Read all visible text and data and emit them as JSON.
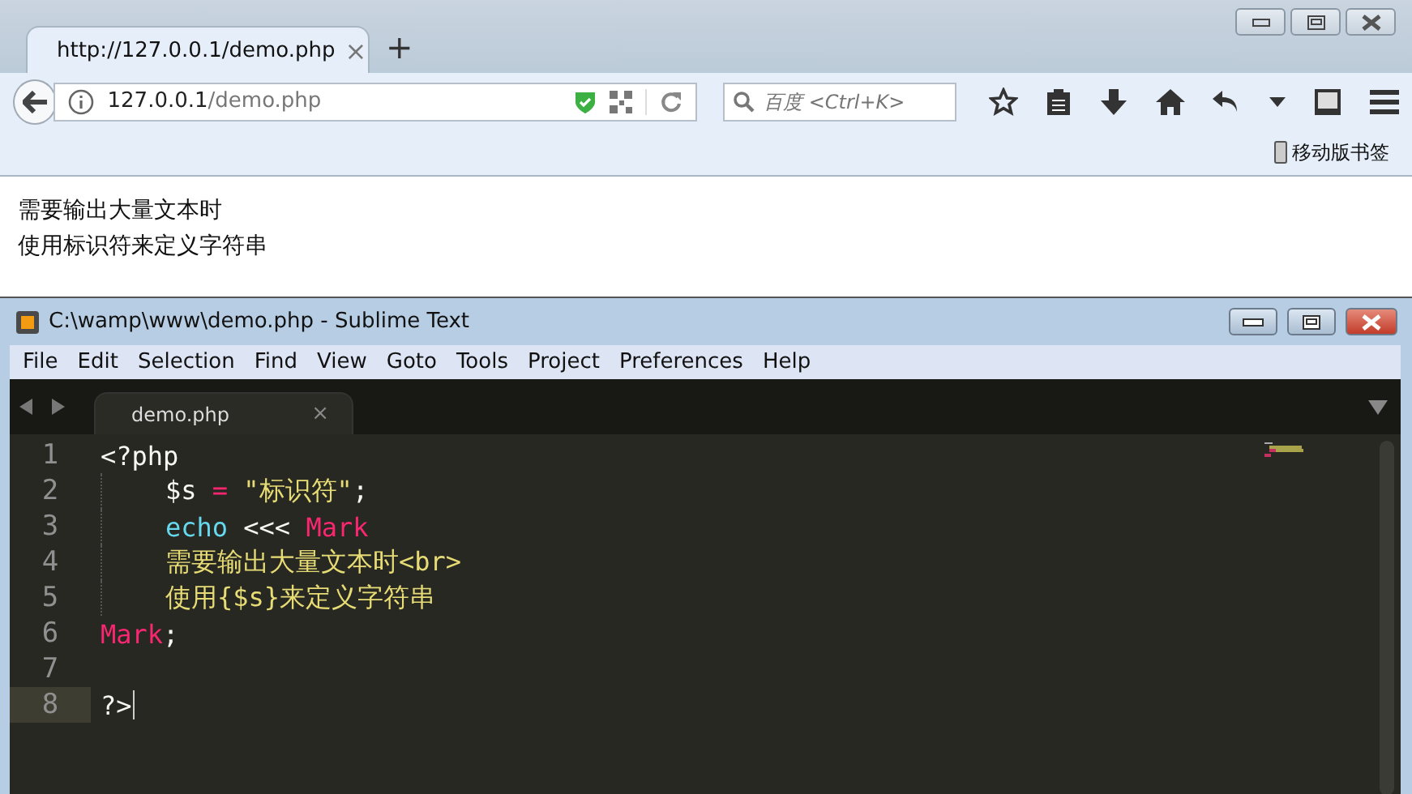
{
  "browser": {
    "tab": {
      "title": "http://127.0.0.1/demo.php",
      "close": "×",
      "selected": true
    },
    "new_tab": "+",
    "address": {
      "host": "127.0.0.1",
      "path": "/demo.php"
    },
    "search": {
      "placeholder": "百度 <Ctrl+K>"
    },
    "bookmarks": [
      "移动版书签"
    ],
    "page_lines": [
      "需要输出大量文本时",
      "使用标识符来定义字符串"
    ]
  },
  "editor": {
    "window": {
      "title": "C:\\wamp\\www\\demo.php - Sublime Text"
    },
    "menu": [
      "File",
      "Edit",
      "Selection",
      "Find",
      "View",
      "Goto",
      "Tools",
      "Project",
      "Preferences",
      "Help"
    ],
    "tab": {
      "label": "demo.php",
      "close": "×",
      "selected": true
    },
    "lines": [
      {
        "number": "1",
        "indented": false,
        "current": false,
        "tokens": [
          {
            "text": "<?php",
            "kind": "plain"
          }
        ]
      },
      {
        "number": "2",
        "indented": true,
        "current": false,
        "tokens": [
          {
            "text": "$s",
            "kind": "plain"
          },
          {
            "text": " = ",
            "kind": "operator"
          },
          {
            "text": "\"标识符\"",
            "kind": "string"
          },
          {
            "text": ";",
            "kind": "plain"
          }
        ]
      },
      {
        "number": "3",
        "indented": true,
        "current": false,
        "tokens": [
          {
            "text": "echo",
            "kind": "keyword"
          },
          {
            "text": " <<< ",
            "kind": "plain"
          },
          {
            "text": "Mark",
            "kind": "operator"
          }
        ]
      },
      {
        "number": "4",
        "indented": true,
        "current": false,
        "tokens": [
          {
            "text": "需要输出大量文本时<br>",
            "kind": "string"
          }
        ]
      },
      {
        "number": "5",
        "indented": true,
        "current": false,
        "tokens": [
          {
            "text": "使用{$s}来定义字符串",
            "kind": "string"
          }
        ]
      },
      {
        "number": "6",
        "indented": false,
        "current": false,
        "tokens": [
          {
            "text": "Mark",
            "kind": "operator"
          },
          {
            "text": ";",
            "kind": "plain"
          }
        ]
      },
      {
        "number": "7",
        "indented": false,
        "current": false
      },
      {
        "number": "8",
        "indented": false,
        "current": true,
        "tokens": [
          {
            "text": "?>",
            "kind": "plain"
          }
        ]
      }
    ]
  }
}
